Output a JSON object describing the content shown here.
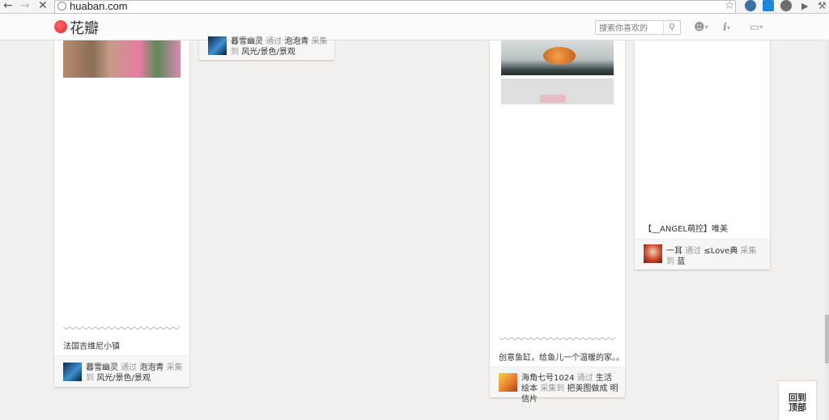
{
  "browser": {
    "url": "huaban.com",
    "back_icon": "arrow-left",
    "forward_icon": "arrow-right",
    "stop_icon": "close-x"
  },
  "site": {
    "logo": "花瓣",
    "search_placeholder": "搜索你喜欢的",
    "colors": {
      "brand": "#e0232e",
      "background": "#f1f0ee"
    }
  },
  "pins": [
    {
      "description": "法国吉维尼小镇",
      "user": "暮雪幽灵",
      "via": "通过",
      "source": "泡泡青",
      "collected": "采集",
      "to": "到",
      "board": "风光/景色/景观"
    },
    {
      "user": "暮雪幽灵",
      "via": "通过",
      "source": "泡泡青",
      "collected": "采集",
      "to": "到",
      "board": "风光/景色/景观"
    },
    {
      "description": "创意鱼缸，给鱼儿一个温暖的家。。",
      "user": "海角七号1024",
      "via": "通过",
      "source": "生活绘本",
      "collected": "采集到",
      "board": "把美图做成 明信片"
    },
    {
      "description": "【__ANGEL萌控】唯美",
      "user": "一耳",
      "via": "通过",
      "source": "≤Love典",
      "collected": "采集到",
      "board": "蓝"
    }
  ],
  "back_to_top": {
    "line1": "回到",
    "line2": "顶部"
  }
}
